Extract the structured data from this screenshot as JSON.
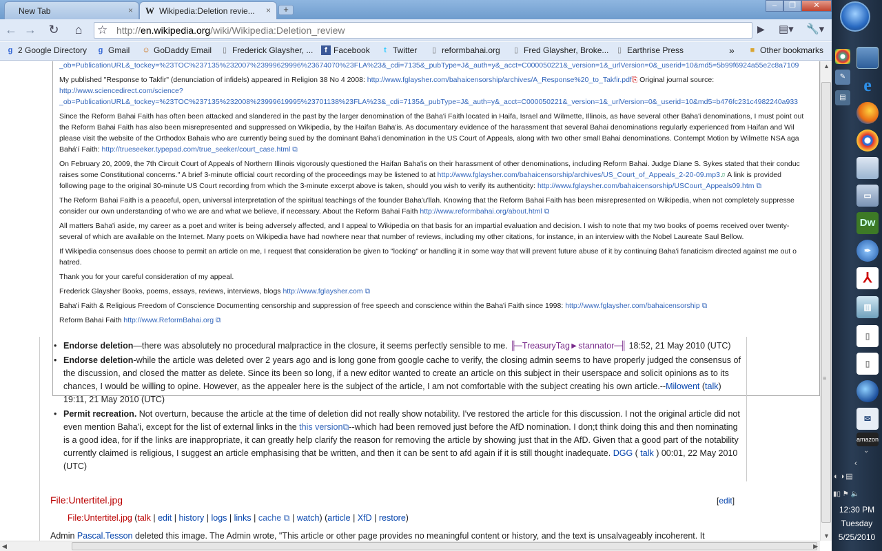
{
  "window": {
    "tabs": [
      {
        "label": "New Tab",
        "active": false
      },
      {
        "label": "Wikipedia:Deletion revie...",
        "active": true
      }
    ],
    "close_glyph": "×",
    "new_tab_glyph": "+"
  },
  "toolbar": {
    "url_scheme": "http://",
    "url_host": "en.wikipedia.org",
    "url_path": "/wiki/Wikipedia:Deletion_review"
  },
  "bookmarks": {
    "items": [
      {
        "label": "2 Google Directory",
        "icon": "google-icon"
      },
      {
        "label": "Gmail",
        "icon": "gmail-icon"
      },
      {
        "label": "GoDaddy Email",
        "icon": "godaddy-icon"
      },
      {
        "label": "Frederick Glaysher, ...",
        "icon": "page-icon"
      },
      {
        "label": "Facebook",
        "icon": "facebook-icon"
      },
      {
        "label": "Twitter",
        "icon": "twitter-icon"
      },
      {
        "label": "reformbahai.org",
        "icon": "page-icon"
      },
      {
        "label": "Fred Glaysher, Broke...",
        "icon": "page-icon"
      },
      {
        "label": "Earthrise Press",
        "icon": "page-icon"
      }
    ],
    "overflow": "»",
    "other": "Other bookmarks"
  },
  "quote": {
    "p1_text": "_ob=PublicationURL&_tockey=%23TOC%237135%232007%23999629996%23674070%23FLA%23&_cdi=7135&_pubType=J&_auth=y&_acct=C000050221&_version=1&_urlVersion=0&_userid=10&md5=5b99f6924a55e2c8a7109",
    "p2_a": "My published \"Response to Takfir\" (denunciation of infidels) appeared in Religion 38 No 4 2008: ",
    "p2_link": "http://www.fglaysher.com/bahaicensorship/archives/A_Response%20_to_Takfir.pdf",
    "p2_b": " Original journal source:",
    "p2_link2": "http://www.sciencedirect.com/science?",
    "p2_link3": "_ob=PublicationURL&_tockey=%23TOC%237135%232008%23999619995%23701138%23FLA%23&_cdi=7135&_pubType=J&_auth=y&_acct=C000050221&_version=1&_urlVersion=0&_userid=10&md5=b476fc231c4982240a933",
    "p3_l1": "Since the Reform Bahai Faith has often been attacked and slandered in the past by the larger denomination of the Baha'i Faith located in Haifa, Israel and Wilmette, Illinois, as have several other Baha'i denominations, I must point out",
    "p3_l2": "the Reform Bahai Faith has also been misrepresented and suppressed on Wikipedia, by the Haifan Baha'is. As documentary evidence of the harassment that several Bahai denominations regularly experienced from Haifan and Wil",
    "p3_l3": "please visit the website of the Orthodox Bahais who are currently being sued by the dominant Baha'i denomination in the US Court of Appeals, along with two other small Bahai denominations. Contempt Motion by Wilmette NSA aga",
    "p3_l4a": "Bahá'í Faith: ",
    "p3_l4link": "http://trueseeker.typepad.com/true_seeker/court_case.html",
    "p4_l1": "On February 20, 2009, the 7th Circuit Court of Appeals of Northern Illinois vigorously questioned the Haifan Baha'is on their harassment of other denominations, including Reform Bahai. Judge Diane S. Sykes stated that their conduc",
    "p4_l2a": "raises some Constitutional concerns.\" A brief 3-minute official court recording of the proceedings may be listened to at ",
    "p4_l2link": "http://www.fglaysher.com/bahaicensorship/archives/US_Court_of_Appeals_2-20-09.mp3",
    "p4_l2b": " A link is provided",
    "p4_l3a": "following page to the original 30-minute US Court recording from which the 3-minute excerpt above is taken, should you wish to verify its authenticity: ",
    "p4_l3link": "http://www.fglaysher.com/bahaicensorship/USCourt_Appeals09.htm",
    "p5_l1": "The Reform Bahai Faith is a peaceful, open, universal interpretation of the spiritual teachings of the founder Baha'u'llah. Knowing that the Reform Bahai Faith has been misrepresented on Wikipedia, when not completely suppresse",
    "p5_l2a": "consider our own understanding of who we are and what we believe, if necessary. About the Reform Bahai Faith ",
    "p5_l2link": "http://www.reformbahai.org/about.html",
    "p6_l1": "All matters Baha'i aside, my career as a poet and writer is being adversely affected, and I appeal to Wikipedia on that basis for an impartial evaluation and decision. I wish to note that my two books of poems received over twenty-",
    "p6_l2": "several of which are available on the Internet. Many poets on Wikipedia have had nowhere near that number of reviews, including my other citations, for instance, in an interview with the Nobel Laureate Saul Bellow.",
    "p7_l1": "If Wikipedia consensus does choose to permit an article on me, I request that consideration be given to \"locking\" or handling it in some way that will prevent future abuse of it by continuing Baha'i fanaticism directed against me out o",
    "p7_l2": "hatred.",
    "p8": "Thank you for your careful consideration of my appeal.",
    "p9a": "Frederick Glaysher Books, poems, essays, reviews, interviews, blogs ",
    "p9link": "http://www.fglaysher.com",
    "p10a": "Baha'i Faith & Religious Freedom of Conscience Documenting censorship and suppression of free speech and conscience within the Baha'i Faith since 1998: ",
    "p10link": "http://www.fglaysher.com/bahaicensorship",
    "p11a": "Reform Bahai Faith ",
    "p11link": "http://www.ReformBahai.org"
  },
  "comments": [
    {
      "bold": "Endorse deletion",
      "text": "—there was absolutely no procedural malpractice in the closure, it seems perfectly sensible to me. ",
      "sig": "╟─TreasuryTag►stannator─╢",
      "tail": " 18:52, 21 May 2010 (UTC)"
    },
    {
      "bold": "Endorse deletion",
      "text": "-while the article was deleted over 2 years ago and is long gone from google cache to verify, the closing admin seems to have properly judged the consensus of the discussion, and closed the matter as delete. Since its been so long, if a new editor wanted to create an article on this subject in their userspace and solicit opinions as to its chances, I would be willing to opine. However, as the appealer here is the subject of the article, I am not comfortable with the subject creating his own article.--",
      "user": "Milowent",
      "talk": "talk",
      "tail": " 19:11, 21 May 2010 (UTC)"
    },
    {
      "bold": "Permit recreation.",
      "text_a": " Not overturn, because the article at the time of deletion did not really show notability. I've restored the article for this discussion. I not the original article did not even mention Baha'i, except for the list of external links in the ",
      "link": "this version",
      "text_b": "--which had been removed just before the AfD nomination. I don;t think doing this and then nominating is a good idea, for if the links are inappropriate, it can greatly help clarify the reason for removing the article by showing just that in the AfD. Given that a good part of the notability currently claimed is religious, I suggest an article emphasising that be written, and then it can be sent to afd again if it is still thought inadequate. ",
      "user": "DGG",
      "talk": "talk",
      "tail": " 00:01, 22 May 2010 (UTC)"
    }
  ],
  "section": {
    "title": "File:Untertitel.jpg",
    "edit": "edit",
    "tools_name": "File:Untertitel.jpg",
    "tools": [
      "talk",
      "edit",
      "history",
      "logs",
      "links",
      "cache",
      "watch"
    ],
    "tools2": [
      "article",
      "XfD",
      "restore"
    ],
    "admin_a": "Admin ",
    "admin_user": "Pascal.Tesson",
    "admin_b": " deleted this image. The Admin wrote, \"This article or other page provides no meaningful content or history, and the text is unsalvageably incoherent. It"
  },
  "taskbar": {
    "time": "12:30 PM",
    "day": "Tuesday",
    "date": "5/25/2010",
    "icons": [
      "chrome-icon",
      "notepad-icon",
      "ie-icon",
      "firefox-icon",
      "chrome-icon",
      "window-icon",
      "computer-icon",
      "dreamweaver-icon",
      "pen-icon",
      "acrobat-icon",
      "book-icon",
      "document-icon",
      "document-icon",
      "google-earth-icon",
      "paper-icon",
      "amazon-icon"
    ],
    "dw_label": "Dw",
    "amazon_label": "amazon"
  }
}
